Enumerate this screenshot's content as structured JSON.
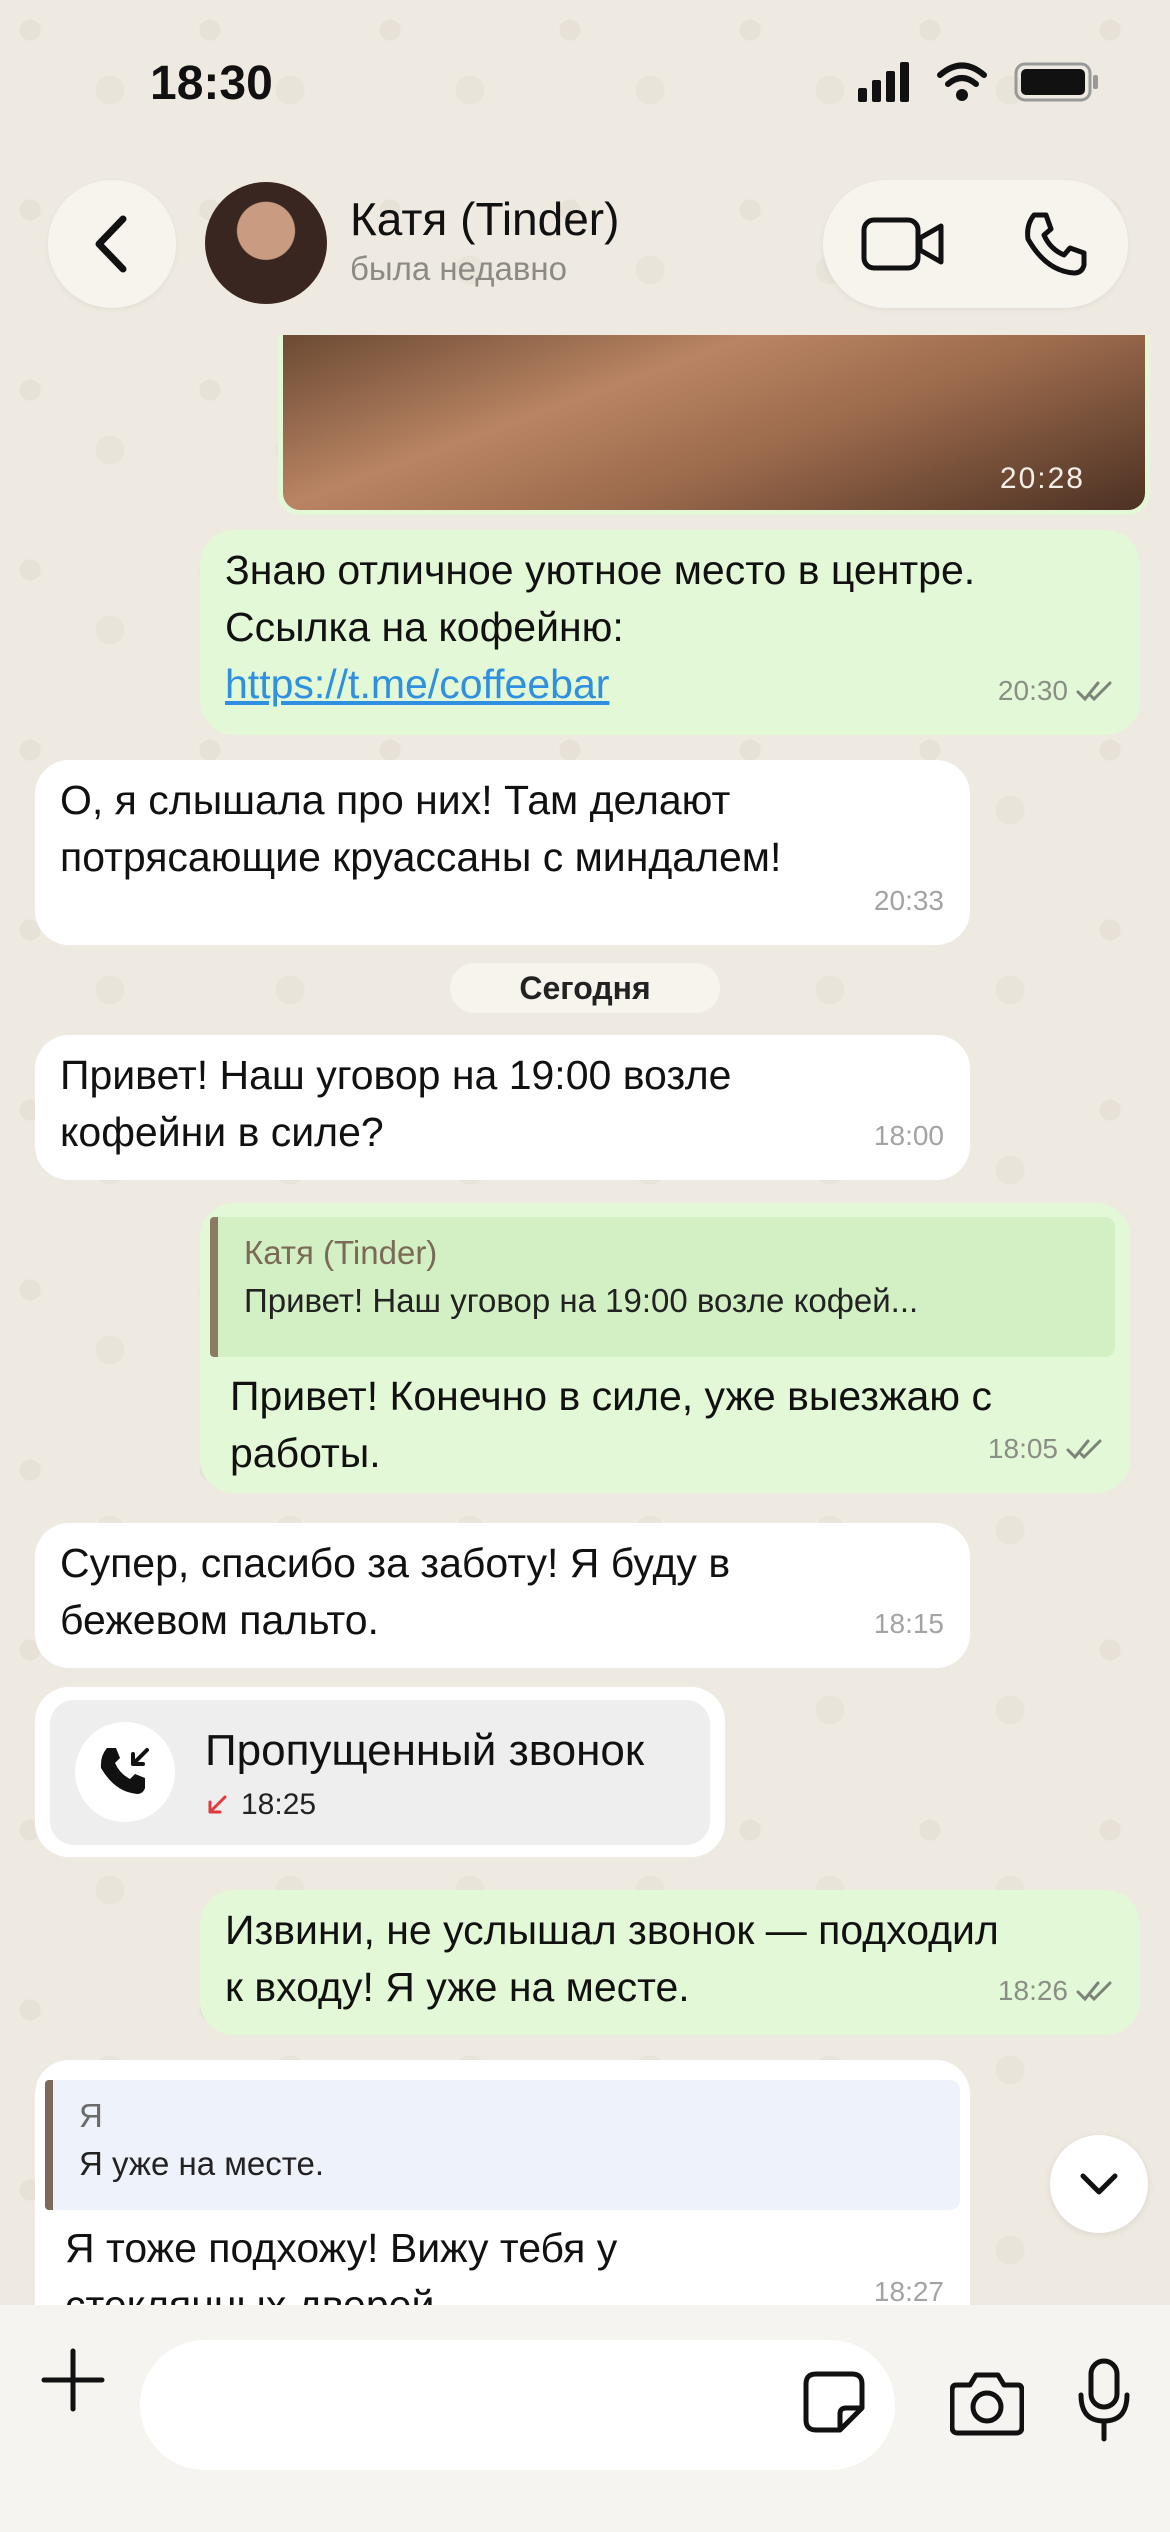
{
  "status_bar": {
    "time": "18:30"
  },
  "header": {
    "contact_name": "Катя (Tinder)",
    "contact_status": "была недавно"
  },
  "messages": {
    "photo_time": "20:28",
    "m1": {
      "line1": "Знаю отличное уютное место в центре.",
      "line2": "Ссылка на кофейню:",
      "link": "https://t.me/coffeebar",
      "time": "20:30"
    },
    "m2": {
      "line1": "О, я слышала про них! Там делают",
      "line2": "потрясающие круассаны с миндалем!",
      "time": "20:33"
    },
    "date_divider": "Сегодня",
    "m3": {
      "line1": "Привет! Наш уговор на 19:00 возле",
      "line2": "кофейни в силе?",
      "time": "18:00"
    },
    "m4": {
      "reply_author": "Катя (Tinder)",
      "reply_text": "Привет! Наш уговор на 19:00 возле кофей...",
      "line1": "Привет! Конечно в силе, уже выезжаю с",
      "line2": "работы.",
      "time": "18:05"
    },
    "m5": {
      "line1": "Супер, спасибо за заботу! Я буду в",
      "line2": "бежевом пальто.",
      "time": "18:15"
    },
    "missed_call": {
      "title": "Пропущенный звонок",
      "time": "18:25"
    },
    "m6": {
      "line1": "Извини, не услышал звонок — подходил",
      "line2": "к входу! Я уже на месте.",
      "time": "18:26"
    },
    "m7": {
      "reply_author": "Я",
      "reply_text": "Я уже на месте.",
      "line1": "Я тоже подхожу! Вижу тебя у",
      "line2": "стеклянных дверей",
      "time": "18:27"
    }
  },
  "composer": {
    "placeholder": ""
  },
  "colors": {
    "outgoing_bubble": "#e3f8d6",
    "incoming_bubble": "#ffffff",
    "link": "#2f8fe0",
    "read_check": "#7c8478",
    "missed_call_arrow": "#e0393e",
    "reply_bar_out": "#8b7b63",
    "reply_bar_in": "#7a6a57"
  }
}
